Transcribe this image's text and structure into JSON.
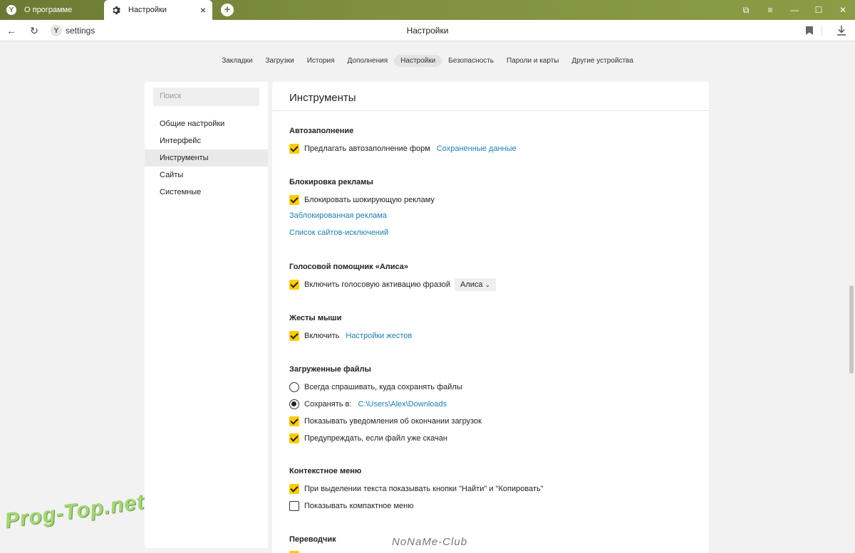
{
  "tabs": [
    {
      "label": "О программе",
      "icon": "yandex-logo-icon",
      "logo_text": "Y"
    },
    {
      "label": "Настройки",
      "icon": "gear-icon",
      "close": "×"
    }
  ],
  "window_controls": {
    "collections": "⧉",
    "menu": "≡",
    "minimize": "—",
    "maximize": "☐",
    "close": "✕"
  },
  "address_bar": {
    "url": "settings",
    "page_title": "Настройки",
    "site_icon_text": "Y"
  },
  "top_nav": [
    {
      "label": "Закладки",
      "active": false
    },
    {
      "label": "Загрузки",
      "active": false
    },
    {
      "label": "История",
      "active": false
    },
    {
      "label": "Дополнения",
      "active": false
    },
    {
      "label": "Настройки",
      "active": true
    },
    {
      "label": "Безопасность",
      "active": false
    },
    {
      "label": "Пароли и карты",
      "active": false
    },
    {
      "label": "Другие устройства",
      "active": false
    }
  ],
  "sidebar": {
    "search_placeholder": "Поиск",
    "items": [
      {
        "label": "Общие настройки",
        "active": false
      },
      {
        "label": "Интерфейс",
        "active": false
      },
      {
        "label": "Инструменты",
        "active": true
      },
      {
        "label": "Сайты",
        "active": false
      },
      {
        "label": "Системные",
        "active": false
      }
    ]
  },
  "main": {
    "title": "Инструменты",
    "sections": {
      "autofill": {
        "title": "Автозаполнение",
        "option": {
          "label": "Предлагать автозаполнение форм",
          "checked": true
        },
        "link": "Сохраненные данные"
      },
      "adblock": {
        "title": "Блокировка рекламы",
        "option": {
          "label": "Блокировать шокирующую рекламу",
          "checked": true
        },
        "link_blocked": "Заблокированная реклама",
        "link_exceptions": "Список сайтов-исключений"
      },
      "alice": {
        "title": "Голосовой помощник «Алиса»",
        "option": {
          "label": "Включить голосовую активацию фразой",
          "checked": true
        },
        "dropdown_value": "Алиса"
      },
      "gestures": {
        "title": "Жесты мыши",
        "option": {
          "label": "Включить",
          "checked": true
        },
        "link": "Настройки жестов"
      },
      "downloads": {
        "title": "Загруженные файлы",
        "radio_ask": {
          "label": "Всегда спрашивать, куда сохранять файлы",
          "selected": false
        },
        "radio_save": {
          "label": "Сохранять в:",
          "selected": true
        },
        "save_path": "C:\\Users\\Alex\\Downloads",
        "notify": {
          "label": "Показывать уведомления об окончании загрузок",
          "checked": true
        },
        "warn": {
          "label": "Предупреждать, если файл уже скачан",
          "checked": true
        }
      },
      "context_menu": {
        "title": "Контекстное меню",
        "show_buttons": {
          "label": "При выделении текста показывать кнопки \"Найти\" и \"Копировать\"",
          "checked": true
        },
        "compact": {
          "label": "Показывать компактное меню",
          "checked": false
        }
      },
      "translator": {
        "title": "Переводчик"
      }
    }
  },
  "watermarks": {
    "left": "Prog-Top.net",
    "center": "NoNaMe-Club"
  },
  "colors": {
    "accent_checkbox": "#ffcc00",
    "link": "#1b7fb0",
    "tabbar": "#7f9140"
  }
}
